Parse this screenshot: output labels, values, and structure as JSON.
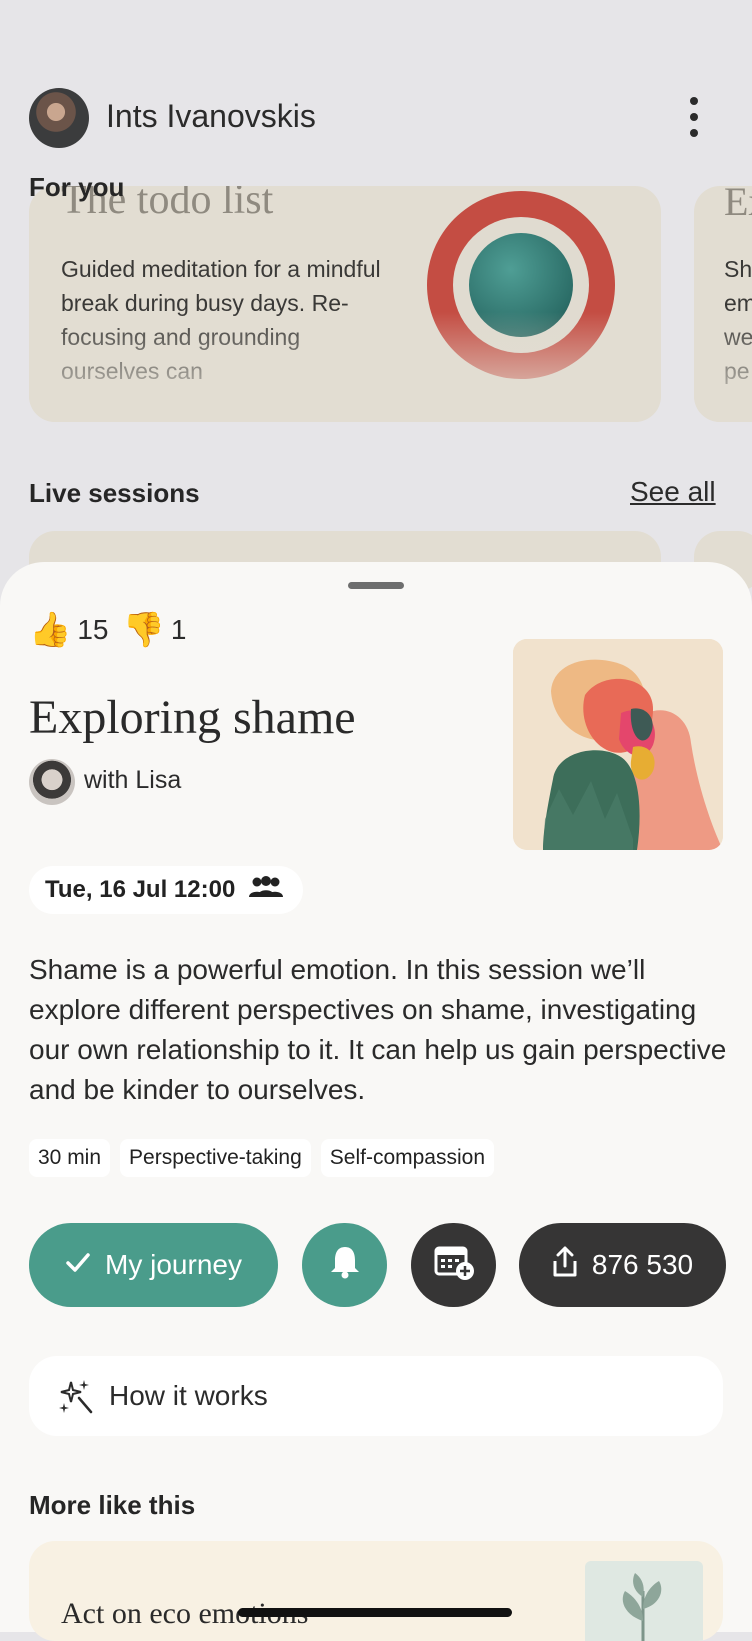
{
  "profile": {
    "name": "Ints Ivanovskis"
  },
  "for_you": {
    "label": "For you",
    "cards": [
      {
        "title": "The todo list",
        "description": "Guided meditation for a mindful break during busy days. Re-focusing and grounding ourselves can"
      },
      {
        "title": "Ex",
        "description": "Sh em we pe"
      }
    ]
  },
  "live_sessions": {
    "label": "Live sessions",
    "see_all": "See all"
  },
  "session": {
    "likes": "15",
    "dislikes": "1",
    "title": "Exploring shame",
    "host": "with Lisa",
    "date": "Tue, 16 Jul 12:00",
    "description": "Shame is a powerful emotion. In this session we’ll explore different perspectives on shame, investigating our own relationship to it. It can help us gain perspective and be kinder to ourselves.",
    "tags": [
      "30 min",
      "Perspective-taking",
      "Self-compassion"
    ],
    "actions": {
      "journey": "My journey",
      "share_count": "876 530"
    },
    "how_it_works": "How it works",
    "more_like_this": "More like this",
    "recommendation": "Act on eco emotions"
  },
  "colors": {
    "accent": "#4a9c8b",
    "dark_button": "#363535",
    "sheet": "#f9f8f6",
    "card": "#e2ddd2"
  },
  "icons": [
    "more-vertical-icon",
    "thumbs-up-icon",
    "thumbs-down-icon",
    "group-icon",
    "check-icon",
    "bell-icon",
    "calendar-add-icon",
    "share-icon",
    "sparkle-icon"
  ]
}
